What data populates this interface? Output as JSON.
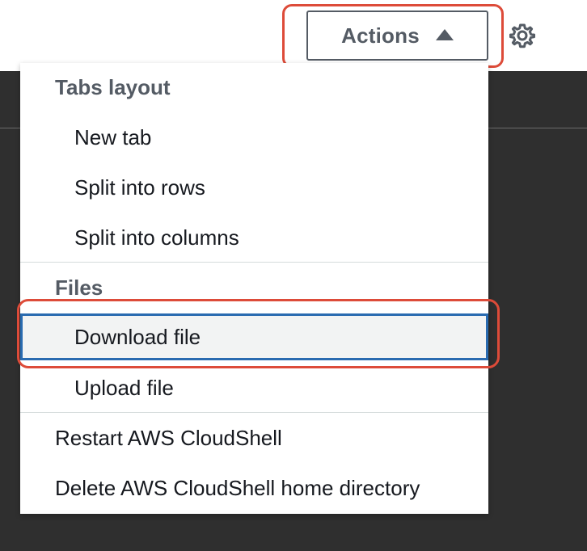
{
  "toolbar": {
    "actions_label": "Actions"
  },
  "icons": {
    "caret": "caret-up-icon",
    "settings": "gear-icon"
  },
  "menu": {
    "tabs_header": "Tabs layout",
    "new_tab": "New tab",
    "split_rows": "Split into rows",
    "split_columns": "Split into columns",
    "files_header": "Files",
    "download_file": "Download file",
    "upload_file": "Upload file",
    "restart": "Restart AWS CloudShell",
    "delete_home": "Delete AWS CloudShell home directory"
  },
  "colors": {
    "highlight": "#dd4b39",
    "selected_border": "#2a6bb0",
    "terminal_bg": "#2f2f2f"
  }
}
